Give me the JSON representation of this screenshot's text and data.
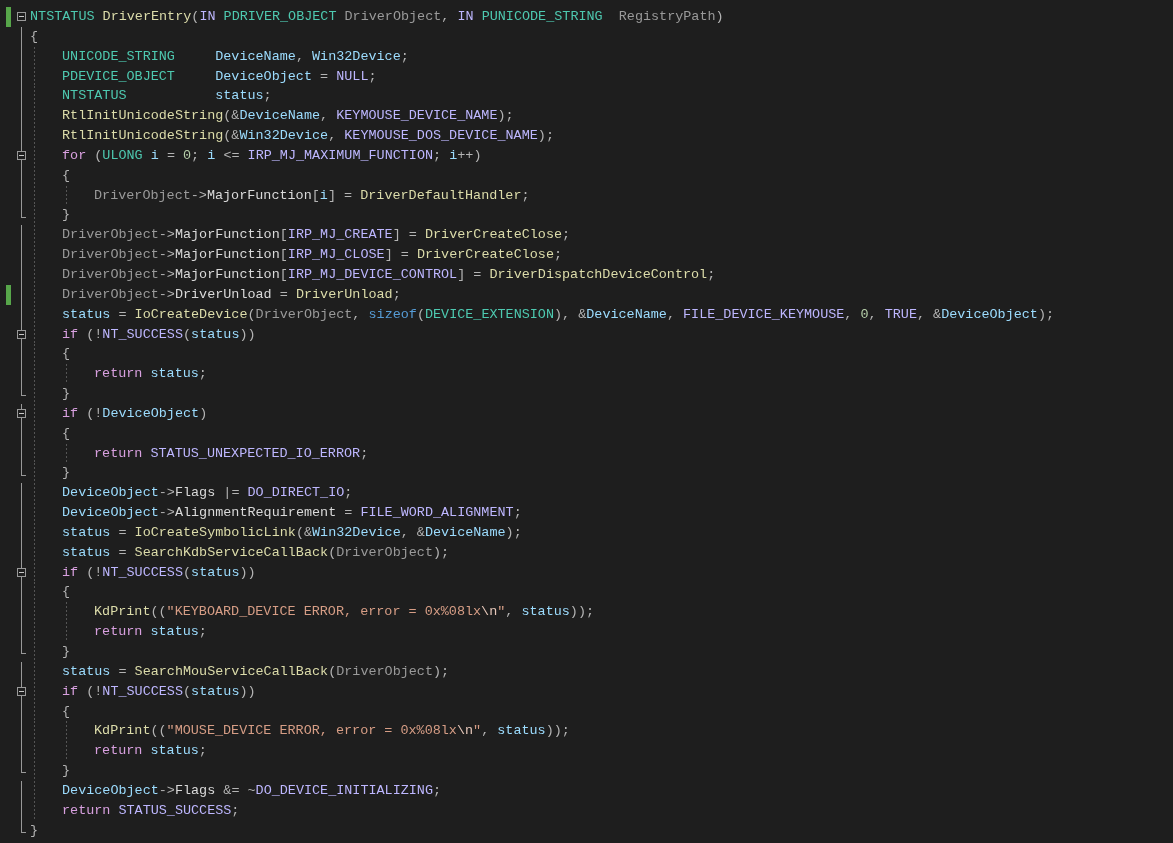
{
  "editor": {
    "code": [
      {
        "changed": true,
        "expanded": true,
        "open": "{",
        "close": "}",
        "tokens": [
          {
            "kind": "type",
            "text": "NTSTATUS"
          },
          {
            "kind": "fn",
            "text": " DriverEntry"
          },
          {
            "kind": "p",
            "text": "("
          },
          {
            "kind": "macro",
            "text": "IN"
          },
          {
            "kind": "type",
            "text": " PDRIVER_OBJECT"
          },
          {
            "kind": "param",
            "text": " DriverObject"
          },
          {
            "kind": "p",
            "text": ", "
          },
          {
            "kind": "macro",
            "text": "IN"
          },
          {
            "kind": "type",
            "text": " PUNICODE_STRING"
          },
          {
            "kind": "param",
            "text": "  RegistryPath"
          },
          {
            "kind": "p",
            "text": ")"
          }
        ],
        "body": [
          {
            "changed": false,
            "tokens": [
              {
                "kind": "type",
                "text": "UNICODE_STRING"
              },
              {
                "kind": "var",
                "text": "     DeviceName"
              },
              {
                "kind": "p",
                "text": ", "
              },
              {
                "kind": "var",
                "text": "Win32Device"
              },
              {
                "kind": "p",
                "text": ";"
              }
            ]
          },
          {
            "changed": false,
            "tokens": [
              {
                "kind": "type",
                "text": "PDEVICE_OBJECT"
              },
              {
                "kind": "var",
                "text": "     DeviceObject"
              },
              {
                "kind": "p",
                "text": " = "
              },
              {
                "kind": "macro",
                "text": "NULL"
              },
              {
                "kind": "p",
                "text": ";"
              }
            ]
          },
          {
            "changed": false,
            "tokens": [
              {
                "kind": "type",
                "text": "NTSTATUS"
              },
              {
                "kind": "var",
                "text": "           status"
              },
              {
                "kind": "p",
                "text": ";"
              }
            ]
          },
          {
            "changed": false,
            "tokens": [
              {
                "kind": "fn",
                "text": "RtlInitUnicodeString"
              },
              {
                "kind": "p",
                "text": "(&"
              },
              {
                "kind": "var",
                "text": "DeviceName"
              },
              {
                "kind": "p",
                "text": ", "
              },
              {
                "kind": "macro",
                "text": "KEYMOUSE_DEVICE_NAME"
              },
              {
                "kind": "p",
                "text": ");"
              }
            ]
          },
          {
            "changed": false,
            "tokens": [
              {
                "kind": "fn",
                "text": "RtlInitUnicodeString"
              },
              {
                "kind": "p",
                "text": "(&"
              },
              {
                "kind": "var",
                "text": "Win32Device"
              },
              {
                "kind": "p",
                "text": ", "
              },
              {
                "kind": "macro",
                "text": "KEYMOUSE_DOS_DEVICE_NAME"
              },
              {
                "kind": "p",
                "text": ");"
              }
            ]
          },
          {
            "changed": false,
            "expanded": true,
            "open": "{",
            "close": "}",
            "tokens": [
              {
                "kind": "ctrl",
                "text": "for"
              },
              {
                "kind": "p",
                "text": " ("
              },
              {
                "kind": "type",
                "text": "ULONG"
              },
              {
                "kind": "var",
                "text": " i"
              },
              {
                "kind": "p",
                "text": " = "
              },
              {
                "kind": "num",
                "text": "0"
              },
              {
                "kind": "p",
                "text": "; "
              },
              {
                "kind": "var",
                "text": "i"
              },
              {
                "kind": "p",
                "text": " <= "
              },
              {
                "kind": "macro",
                "text": "IRP_MJ_MAXIMUM_FUNCTION"
              },
              {
                "kind": "p",
                "text": "; "
              },
              {
                "kind": "var",
                "text": "i"
              },
              {
                "kind": "p",
                "text": "++)"
              }
            ],
            "body": [
              {
                "changed": false,
                "tokens": [
                  {
                    "kind": "param",
                    "text": "DriverObject"
                  },
                  {
                    "kind": "p",
                    "text": "->"
                  },
                  {
                    "kind": "member",
                    "text": "MajorFunction"
                  },
                  {
                    "kind": "p",
                    "text": "["
                  },
                  {
                    "kind": "var",
                    "text": "i"
                  },
                  {
                    "kind": "p",
                    "text": "] = "
                  },
                  {
                    "kind": "fn",
                    "text": "DriverDefaultHandler"
                  },
                  {
                    "kind": "p",
                    "text": ";"
                  }
                ]
              }
            ]
          },
          {
            "changed": false,
            "tokens": [
              {
                "kind": "param",
                "text": "DriverObject"
              },
              {
                "kind": "p",
                "text": "->"
              },
              {
                "kind": "member",
                "text": "MajorFunction"
              },
              {
                "kind": "p",
                "text": "["
              },
              {
                "kind": "macro",
                "text": "IRP_MJ_CREATE"
              },
              {
                "kind": "p",
                "text": "] = "
              },
              {
                "kind": "fn",
                "text": "DriverCreateClose"
              },
              {
                "kind": "p",
                "text": ";"
              }
            ]
          },
          {
            "changed": false,
            "tokens": [
              {
                "kind": "param",
                "text": "DriverObject"
              },
              {
                "kind": "p",
                "text": "->"
              },
              {
                "kind": "member",
                "text": "MajorFunction"
              },
              {
                "kind": "p",
                "text": "["
              },
              {
                "kind": "macro",
                "text": "IRP_MJ_CLOSE"
              },
              {
                "kind": "p",
                "text": "] = "
              },
              {
                "kind": "fn",
                "text": "DriverCreateClose"
              },
              {
                "kind": "p",
                "text": ";"
              }
            ]
          },
          {
            "changed": false,
            "tokens": [
              {
                "kind": "param",
                "text": "DriverObject"
              },
              {
                "kind": "p",
                "text": "->"
              },
              {
                "kind": "member",
                "text": "MajorFunction"
              },
              {
                "kind": "p",
                "text": "["
              },
              {
                "kind": "macro",
                "text": "IRP_MJ_DEVICE_CONTROL"
              },
              {
                "kind": "p",
                "text": "] = "
              },
              {
                "kind": "fn",
                "text": "DriverDispatchDeviceControl"
              },
              {
                "kind": "p",
                "text": ";"
              }
            ]
          },
          {
            "changed": true,
            "tokens": [
              {
                "kind": "param",
                "text": "DriverObject"
              },
              {
                "kind": "p",
                "text": "->"
              },
              {
                "kind": "member",
                "text": "DriverUnload"
              },
              {
                "kind": "p",
                "text": " = "
              },
              {
                "kind": "fn",
                "text": "DriverUnload"
              },
              {
                "kind": "p",
                "text": ";"
              }
            ]
          },
          {
            "changed": false,
            "tokens": [
              {
                "kind": "var",
                "text": "status"
              },
              {
                "kind": "p",
                "text": " = "
              },
              {
                "kind": "fn",
                "text": "IoCreateDevice"
              },
              {
                "kind": "p",
                "text": "("
              },
              {
                "kind": "param",
                "text": "DriverObject"
              },
              {
                "kind": "p",
                "text": ", "
              },
              {
                "kind": "kw",
                "text": "sizeof"
              },
              {
                "kind": "p",
                "text": "("
              },
              {
                "kind": "type",
                "text": "DEVICE_EXTENSION"
              },
              {
                "kind": "p",
                "text": "), &"
              },
              {
                "kind": "var",
                "text": "DeviceName"
              },
              {
                "kind": "p",
                "text": ", "
              },
              {
                "kind": "macro",
                "text": "FILE_DEVICE_KEYMOUSE"
              },
              {
                "kind": "p",
                "text": ", "
              },
              {
                "kind": "num",
                "text": "0"
              },
              {
                "kind": "p",
                "text": ", "
              },
              {
                "kind": "macro",
                "text": "TRUE"
              },
              {
                "kind": "p",
                "text": ", &"
              },
              {
                "kind": "var",
                "text": "DeviceObject"
              },
              {
                "kind": "p",
                "text": ");"
              }
            ]
          },
          {
            "changed": false,
            "expanded": true,
            "open": "{",
            "close": "}",
            "tokens": [
              {
                "kind": "ctrl",
                "text": "if"
              },
              {
                "kind": "p",
                "text": " (!"
              },
              {
                "kind": "macro",
                "text": "NT_SUCCESS"
              },
              {
                "kind": "p",
                "text": "("
              },
              {
                "kind": "var",
                "text": "status"
              },
              {
                "kind": "p",
                "text": "))"
              }
            ],
            "body": [
              {
                "changed": false,
                "tokens": [
                  {
                    "kind": "ctrl",
                    "text": "return"
                  },
                  {
                    "kind": "var",
                    "text": " status"
                  },
                  {
                    "kind": "p",
                    "text": ";"
                  }
                ]
              }
            ]
          },
          {
            "changed": false,
            "expanded": true,
            "open": "{",
            "close": "}",
            "tokens": [
              {
                "kind": "ctrl",
                "text": "if"
              },
              {
                "kind": "p",
                "text": " (!"
              },
              {
                "kind": "var",
                "text": "DeviceObject"
              },
              {
                "kind": "p",
                "text": ")"
              }
            ],
            "body": [
              {
                "changed": false,
                "tokens": [
                  {
                    "kind": "ctrl",
                    "text": "return"
                  },
                  {
                    "kind": "macro",
                    "text": " STATUS_UNEXPECTED_IO_ERROR"
                  },
                  {
                    "kind": "p",
                    "text": ";"
                  }
                ]
              }
            ]
          },
          {
            "changed": false,
            "tokens": [
              {
                "kind": "var",
                "text": "DeviceObject"
              },
              {
                "kind": "p",
                "text": "->"
              },
              {
                "kind": "member",
                "text": "Flags"
              },
              {
                "kind": "p",
                "text": " |= "
              },
              {
                "kind": "macro",
                "text": "DO_DIRECT_IO"
              },
              {
                "kind": "p",
                "text": ";"
              }
            ]
          },
          {
            "changed": false,
            "tokens": [
              {
                "kind": "var",
                "text": "DeviceObject"
              },
              {
                "kind": "p",
                "text": "->"
              },
              {
                "kind": "member",
                "text": "AlignmentRequirement"
              },
              {
                "kind": "p",
                "text": " = "
              },
              {
                "kind": "macro",
                "text": "FILE_WORD_ALIGNMENT"
              },
              {
                "kind": "p",
                "text": ";"
              }
            ]
          },
          {
            "changed": false,
            "tokens": [
              {
                "kind": "var",
                "text": "status"
              },
              {
                "kind": "p",
                "text": " = "
              },
              {
                "kind": "fn",
                "text": "IoCreateSymbolicLink"
              },
              {
                "kind": "p",
                "text": "(&"
              },
              {
                "kind": "var",
                "text": "Win32Device"
              },
              {
                "kind": "p",
                "text": ", &"
              },
              {
                "kind": "var",
                "text": "DeviceName"
              },
              {
                "kind": "p",
                "text": ");"
              }
            ]
          },
          {
            "changed": false,
            "tokens": [
              {
                "kind": "var",
                "text": "status"
              },
              {
                "kind": "p",
                "text": " = "
              },
              {
                "kind": "fn",
                "text": "SearchKdbServiceCallBack"
              },
              {
                "kind": "p",
                "text": "("
              },
              {
                "kind": "param",
                "text": "DriverObject"
              },
              {
                "kind": "p",
                "text": ");"
              }
            ]
          },
          {
            "changed": false,
            "expanded": true,
            "open": "{",
            "close": "}",
            "tokens": [
              {
                "kind": "ctrl",
                "text": "if"
              },
              {
                "kind": "p",
                "text": " (!"
              },
              {
                "kind": "macro",
                "text": "NT_SUCCESS"
              },
              {
                "kind": "p",
                "text": "("
              },
              {
                "kind": "var",
                "text": "status"
              },
              {
                "kind": "p",
                "text": "))"
              }
            ],
            "body": [
              {
                "changed": false,
                "tokens": [
                  {
                    "kind": "fn",
                    "text": "KdPrint"
                  },
                  {
                    "kind": "p",
                    "text": "(("
                  },
                  {
                    "kind": "str",
                    "text": "\"KEYBOARD_DEVICE ERROR, error = 0x%08lx"
                  },
                  {
                    "kind": "esc",
                    "text": "\\n"
                  },
                  {
                    "kind": "str",
                    "text": "\""
                  },
                  {
                    "kind": "p",
                    "text": ", "
                  },
                  {
                    "kind": "var",
                    "text": "status"
                  },
                  {
                    "kind": "p",
                    "text": "));"
                  }
                ]
              },
              {
                "changed": false,
                "tokens": [
                  {
                    "kind": "ctrl",
                    "text": "return"
                  },
                  {
                    "kind": "var",
                    "text": " status"
                  },
                  {
                    "kind": "p",
                    "text": ";"
                  }
                ]
              }
            ]
          },
          {
            "changed": false,
            "tokens": [
              {
                "kind": "var",
                "text": "status"
              },
              {
                "kind": "p",
                "text": " = "
              },
              {
                "kind": "fn",
                "text": "SearchMouServiceCallBack"
              },
              {
                "kind": "p",
                "text": "("
              },
              {
                "kind": "param",
                "text": "DriverObject"
              },
              {
                "kind": "p",
                "text": ");"
              }
            ]
          },
          {
            "changed": false,
            "expanded": true,
            "open": "{",
            "close": "}",
            "tokens": [
              {
                "kind": "ctrl",
                "text": "if"
              },
              {
                "kind": "p",
                "text": " (!"
              },
              {
                "kind": "macro",
                "text": "NT_SUCCESS"
              },
              {
                "kind": "p",
                "text": "("
              },
              {
                "kind": "var",
                "text": "status"
              },
              {
                "kind": "p",
                "text": "))"
              }
            ],
            "body": [
              {
                "changed": false,
                "tokens": [
                  {
                    "kind": "fn",
                    "text": "KdPrint"
                  },
                  {
                    "kind": "p",
                    "text": "(("
                  },
                  {
                    "kind": "str",
                    "text": "\"MOUSE_DEVICE ERROR, error = 0x%08lx"
                  },
                  {
                    "kind": "esc",
                    "text": "\\n"
                  },
                  {
                    "kind": "str",
                    "text": "\""
                  },
                  {
                    "kind": "p",
                    "text": ", "
                  },
                  {
                    "kind": "var",
                    "text": "status"
                  },
                  {
                    "kind": "p",
                    "text": "));"
                  }
                ]
              },
              {
                "changed": false,
                "tokens": [
                  {
                    "kind": "ctrl",
                    "text": "return"
                  },
                  {
                    "kind": "var",
                    "text": " status"
                  },
                  {
                    "kind": "p",
                    "text": ";"
                  }
                ]
              }
            ]
          },
          {
            "changed": false,
            "tokens": [
              {
                "kind": "var",
                "text": "DeviceObject"
              },
              {
                "kind": "p",
                "text": "->"
              },
              {
                "kind": "member",
                "text": "Flags"
              },
              {
                "kind": "p",
                "text": " &= ~"
              },
              {
                "kind": "macro",
                "text": "DO_DEVICE_INITIALIZING"
              },
              {
                "kind": "p",
                "text": ";"
              }
            ]
          },
          {
            "changed": false,
            "tokens": [
              {
                "kind": "ctrl",
                "text": "return"
              },
              {
                "kind": "macro",
                "text": " STATUS_SUCCESS"
              },
              {
                "kind": "p",
                "text": ";"
              }
            ]
          }
        ]
      }
    ]
  }
}
